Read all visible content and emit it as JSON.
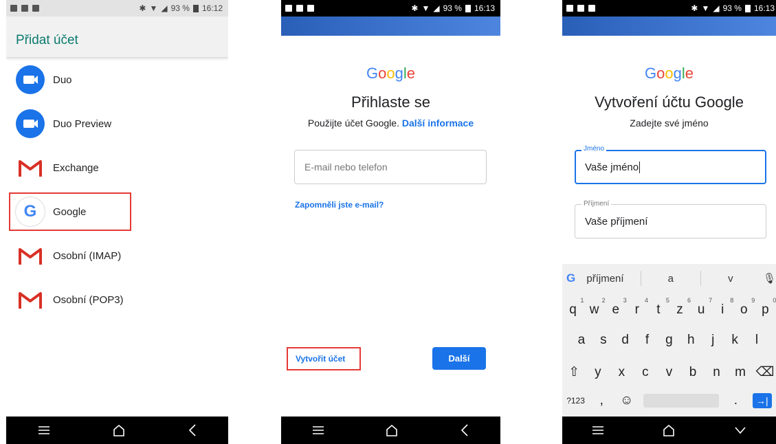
{
  "status": {
    "s1": {
      "battery": "93 %",
      "time": "16:12"
    },
    "s2": {
      "battery": "93 %",
      "time": "16:13"
    },
    "s3": {
      "battery": "93 %",
      "time": "16:13"
    }
  },
  "screen1": {
    "title": "Přidat účet",
    "items": [
      {
        "label": "Duo",
        "icon": "duo-icon"
      },
      {
        "label": "Duo Preview",
        "icon": "duo-icon"
      },
      {
        "label": "Exchange",
        "icon": "gmail-icon"
      },
      {
        "label": "Google",
        "icon": "google-icon"
      },
      {
        "label": "Osobní (IMAP)",
        "icon": "gmail-icon"
      },
      {
        "label": "Osobní (POP3)",
        "icon": "gmail-icon"
      }
    ]
  },
  "screen2": {
    "logo": "Google",
    "heading": "Přihlaste se",
    "subtitle": "Použijte účet Google.",
    "more_info": "Další informace",
    "email_placeholder": "E-mail nebo telefon",
    "forgot": "Zapomněli jste e-mail?",
    "create": "Vytvořit účet",
    "next": "Další"
  },
  "screen3": {
    "logo": "Google",
    "heading": "Vytvoření účtu Google",
    "subtitle": "Zadejte své jméno",
    "first_label": "Jméno",
    "first_value": "Vaše jméno",
    "last_label": "Příjmení",
    "last_value": "Vaše příjmení"
  },
  "keyboard": {
    "suggestions": [
      "příjmení",
      "a",
      "v"
    ],
    "row1": [
      "q",
      "w",
      "e",
      "r",
      "t",
      "z",
      "u",
      "i",
      "o",
      "p"
    ],
    "row1_hints": [
      "1",
      "2",
      "3",
      "4",
      "5",
      "6",
      "7",
      "8",
      "9",
      "0"
    ],
    "row2": [
      "a",
      "s",
      "d",
      "f",
      "g",
      "h",
      "j",
      "k",
      "l"
    ],
    "row3": [
      "y",
      "x",
      "c",
      "v",
      "b",
      "n",
      "m"
    ],
    "sym": "?123",
    "comma": ",",
    "period": "."
  },
  "colors": {
    "accent": "#1a73e8",
    "header_text": "#0b7a6e",
    "highlight": "#e53935"
  }
}
